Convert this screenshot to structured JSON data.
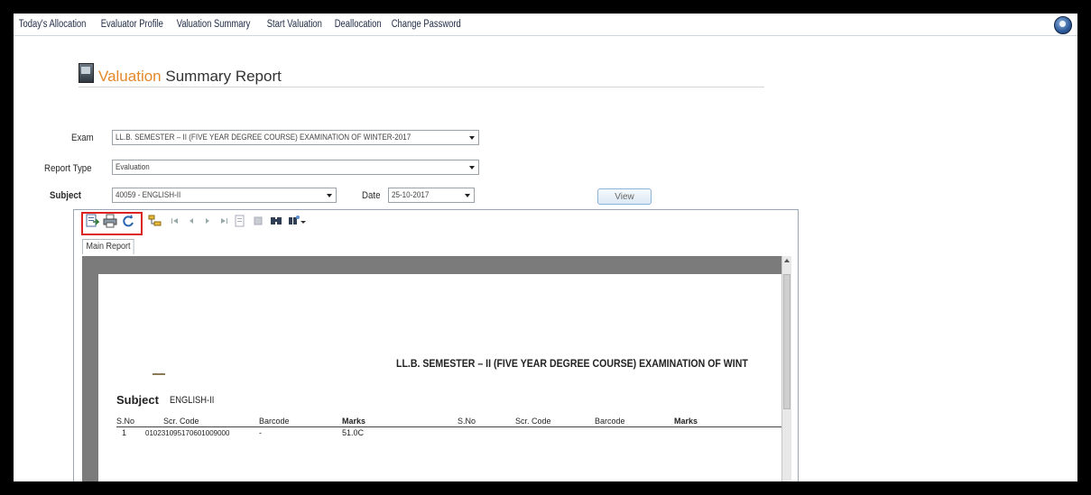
{
  "menu": {
    "items": [
      "Today's Allocation",
      "Evaluator Profile",
      "Valuation Summary",
      "Start Valuation",
      "Deallocation",
      "Change Password"
    ]
  },
  "page_title": {
    "accent": "Valuation",
    "rest": " Summary Report"
  },
  "form": {
    "exam_label": "Exam",
    "exam_value": "LL.B. SEMESTER – II (FIVE YEAR DEGREE COURSE) EXAMINATION OF WINTER-2017",
    "report_type_label": "Report Type",
    "report_type_value": "Evaluation",
    "subject_label": "Subject",
    "subject_value": "40059 - ENGLISH-II",
    "date_label": "Date",
    "date_value": "25-10-2017",
    "view_button": "View"
  },
  "viewer": {
    "tab_label": "Main Report",
    "toolbar_icons": [
      "export-icon",
      "print-icon",
      "refresh-icon",
      "group-tree-icon",
      "first-page-icon",
      "previous-page-icon",
      "next-page-icon",
      "last-page-icon",
      "goto-page-icon",
      "stop-icon",
      "search-icon",
      "zoom-icon"
    ]
  },
  "report": {
    "heading": "LL.B. SEMESTER – II (FIVE YEAR DEGREE COURSE) EXAMINATION OF WINT",
    "subject_label": "Subject",
    "subject_value": "ENGLISH-II",
    "columns": [
      "S.No",
      "Scr. Code",
      "Barcode",
      "Marks",
      "S.No",
      "Scr. Code",
      "Barcode",
      "Marks"
    ],
    "rows": [
      {
        "sno": "1",
        "scr_code": "010231095170601009000",
        "barcode": "-",
        "marks": "51.0C"
      }
    ]
  },
  "colors": {
    "accent": "#e4882a",
    "highlight_box": "#dd2222",
    "report_background": "#7b7b7b"
  }
}
